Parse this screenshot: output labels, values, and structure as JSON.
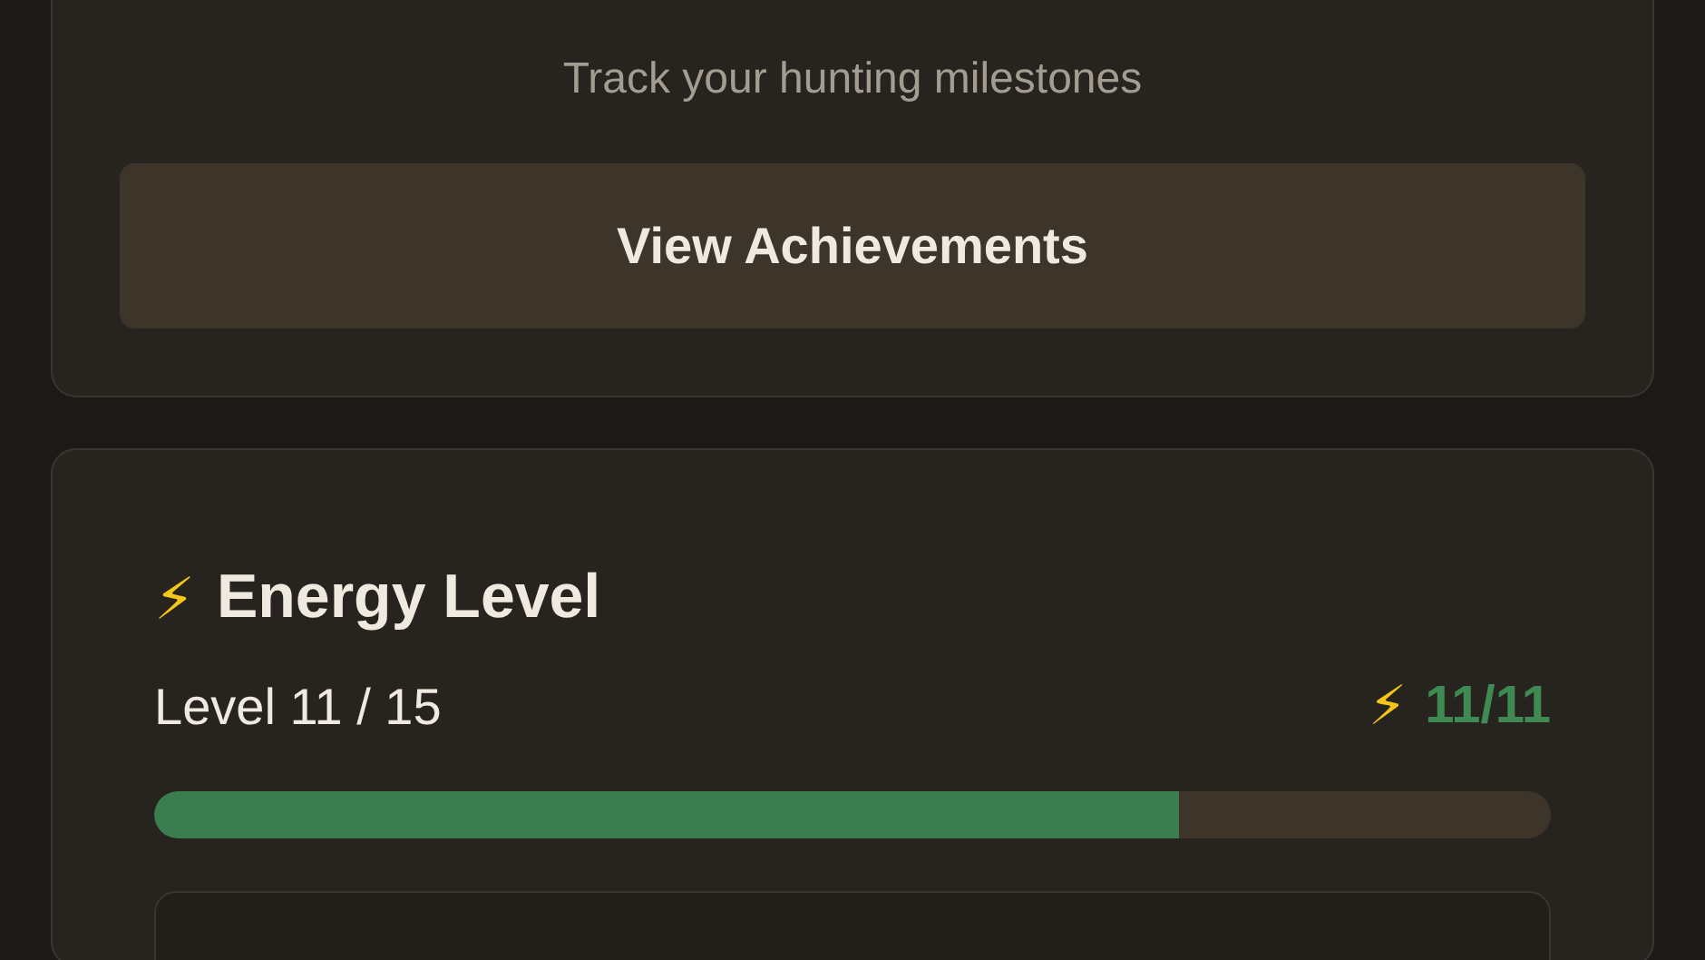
{
  "achievements_card": {
    "subtitle": "Track your hunting milestones",
    "button": "View Achievements"
  },
  "energy_card": {
    "icon": "⚡",
    "title": "Energy Level",
    "level_text": "Level 11 / 15",
    "energy_icon": "⚡",
    "energy_reading": "11/11",
    "level": 0.734
  }
}
